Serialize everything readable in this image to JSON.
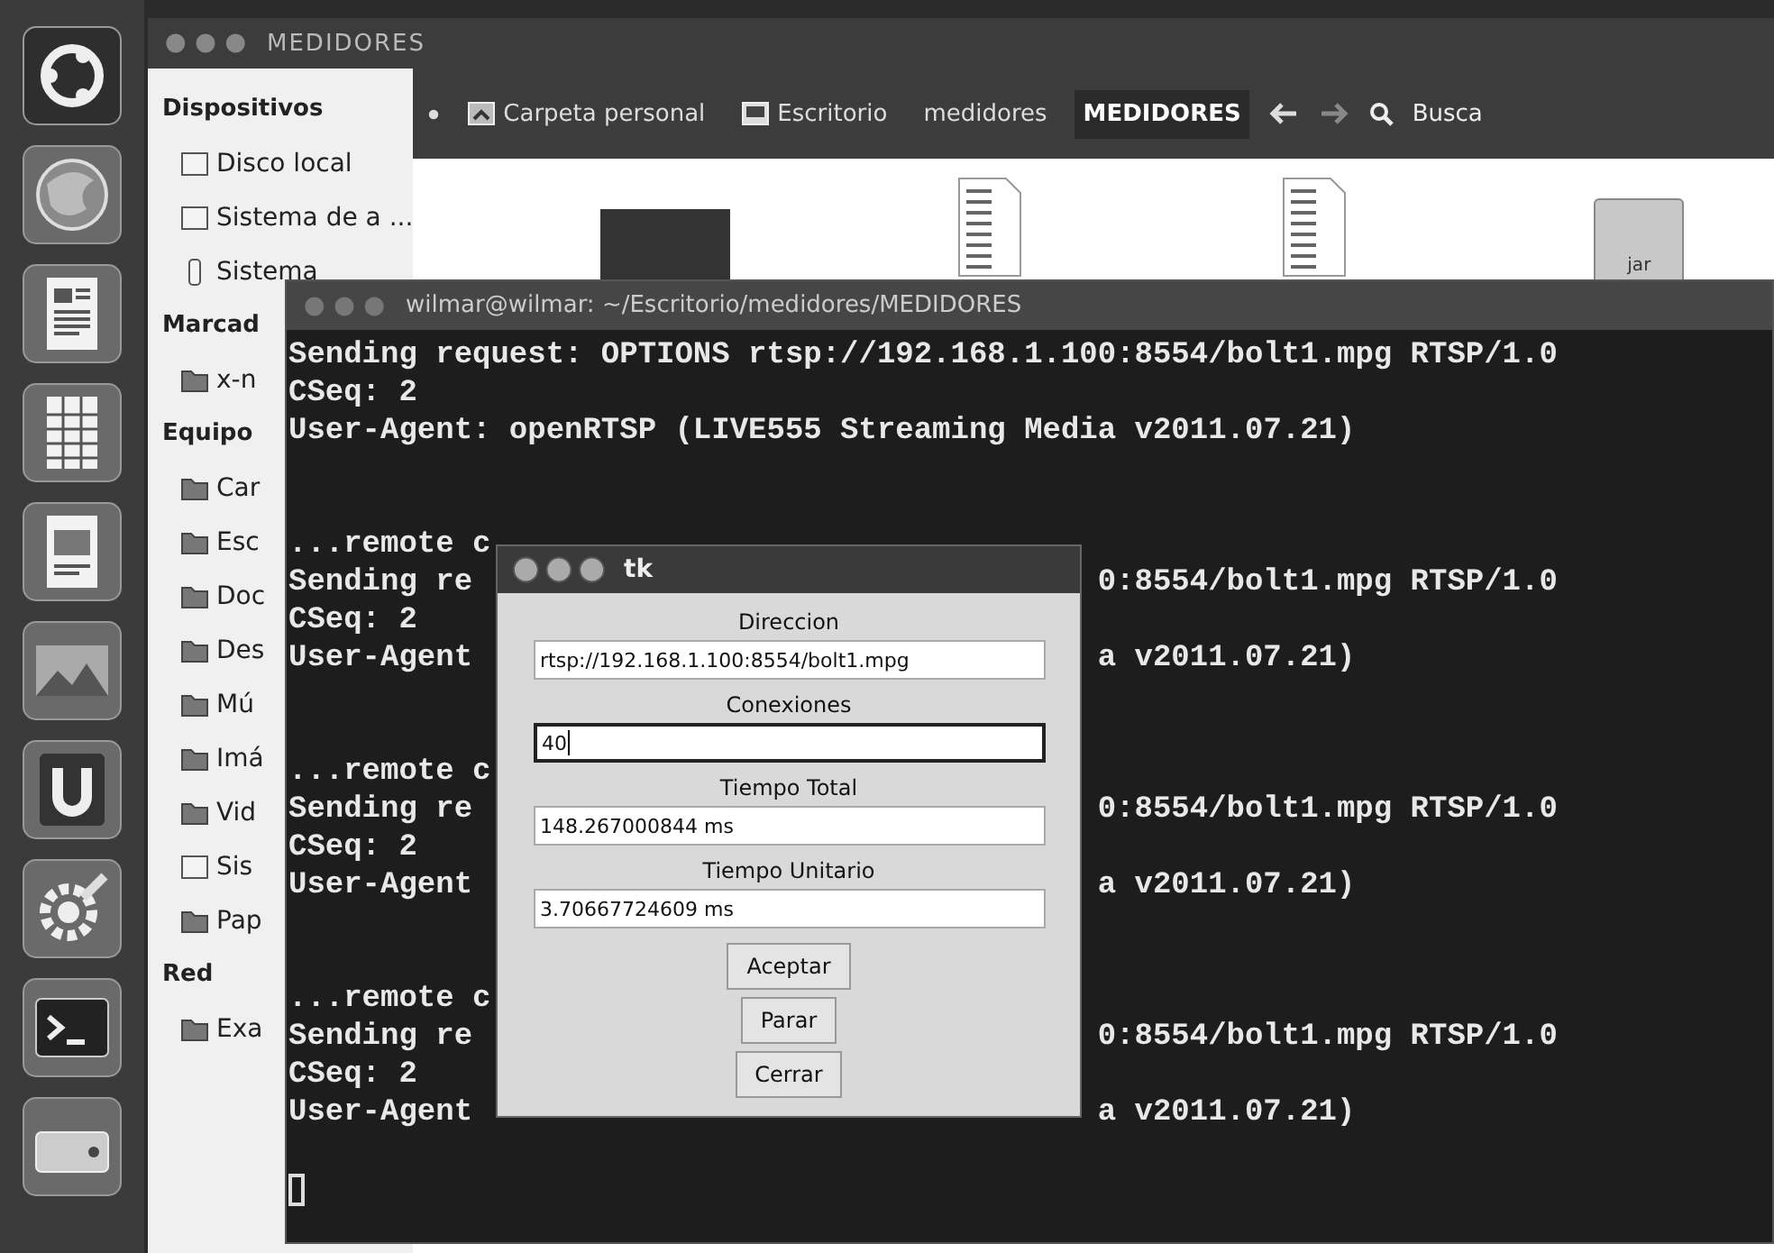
{
  "launcher": {
    "items": [
      {
        "kind": "logo"
      },
      {
        "kind": "globe"
      },
      {
        "kind": "document"
      },
      {
        "kind": "spreadsheet"
      },
      {
        "kind": "presentation"
      },
      {
        "kind": "photo"
      },
      {
        "kind": "app"
      },
      {
        "kind": "settings"
      },
      {
        "kind": "terminal"
      },
      {
        "kind": "drive"
      }
    ]
  },
  "file_manager": {
    "title": "MEDIDORES",
    "breadcrumbs": [
      {
        "label": "Carpeta personal",
        "kind": "home",
        "selected": false
      },
      {
        "label": "Escritorio",
        "kind": "desktop",
        "selected": false
      },
      {
        "label": "medidores",
        "kind": "plain",
        "selected": false
      },
      {
        "label": "MEDIDORES",
        "kind": "plain",
        "selected": true
      }
    ],
    "search_label": "Busca",
    "sidebar": {
      "sections": [
        {
          "heading": "Dispositivos",
          "items": [
            {
              "label": "Disco local",
              "kind": "drive"
            },
            {
              "label": "Sistema de a ...",
              "kind": "drive"
            },
            {
              "label": "Sistema",
              "kind": "usb"
            }
          ]
        },
        {
          "heading": "Marcad",
          "items": [
            {
              "label": "x-n",
              "kind": "folder"
            }
          ]
        },
        {
          "heading": "Equipo",
          "items": [
            {
              "label": "Car",
              "kind": "folder"
            },
            {
              "label": "Esc",
              "kind": "folder"
            },
            {
              "label": "Doc",
              "kind": "folder"
            },
            {
              "label": "Des",
              "kind": "folder"
            },
            {
              "label": "Mú",
              "kind": "folder"
            },
            {
              "label": "Imá",
              "kind": "folder"
            },
            {
              "label": "Vid",
              "kind": "folder"
            },
            {
              "label": "Sis",
              "kind": "drive"
            },
            {
              "label": "Pap",
              "kind": "folder"
            }
          ]
        },
        {
          "heading": "Red",
          "items": [
            {
              "label": "Exa",
              "kind": "folder"
            }
          ]
        }
      ]
    },
    "files": [
      {
        "kind": "image"
      },
      {
        "kind": "text"
      },
      {
        "kind": "text"
      },
      {
        "kind": "archive",
        "badge": "jar"
      }
    ]
  },
  "terminal": {
    "title": "wilmar@wilmar: ~/Escritorio/medidores/MEDIDORES",
    "lines": [
      {
        "kind": "text",
        "left": "Sending request: OPTIONS rtsp://192.168.1.100:8554/bolt1.mpg RTSP/1.0"
      },
      {
        "kind": "text",
        "left": "CSeq: 2"
      },
      {
        "kind": "text",
        "left": "User-Agent: openRTSP (LIVE555 Streaming Media v2011.07.21)"
      },
      {
        "kind": "blank"
      },
      {
        "kind": "blank"
      },
      {
        "kind": "text",
        "left": "...remote c"
      },
      {
        "kind": "text",
        "left": "Sending re",
        "right": "0:8554/bolt1.mpg RTSP/1.0"
      },
      {
        "kind": "text",
        "left": "CSeq: 2"
      },
      {
        "kind": "text",
        "left": "User-Agent",
        "right": "a v2011.07.21)"
      },
      {
        "kind": "blank"
      },
      {
        "kind": "blank"
      },
      {
        "kind": "text",
        "left": "...remote c"
      },
      {
        "kind": "text",
        "left": "Sending re",
        "right": "0:8554/bolt1.mpg RTSP/1.0"
      },
      {
        "kind": "text",
        "left": "CSeq: 2"
      },
      {
        "kind": "text",
        "left": "User-Agent",
        "right": "a v2011.07.21)"
      },
      {
        "kind": "blank"
      },
      {
        "kind": "blank"
      },
      {
        "kind": "text",
        "left": "...remote c"
      },
      {
        "kind": "text",
        "left": "Sending re",
        "right": "0:8554/bolt1.mpg RTSP/1.0"
      },
      {
        "kind": "text",
        "left": "CSeq: 2"
      },
      {
        "kind": "text",
        "left": "User-Agent",
        "right": "a v2011.07.21)"
      },
      {
        "kind": "blank"
      },
      {
        "kind": "cursor"
      }
    ]
  },
  "dialog": {
    "title": "tk",
    "fields": [
      {
        "label": "Direccion",
        "value": "rtsp://192.168.1.100:8554/bolt1.mpg",
        "focused": false
      },
      {
        "label": "Conexiones",
        "value": "40",
        "focused": true
      },
      {
        "label": "Tiempo Total",
        "value": "148.267000844 ms",
        "focused": false
      },
      {
        "label": "Tiempo Unitario",
        "value": "3.70667724609 ms",
        "focused": false
      }
    ],
    "buttons": [
      "Aceptar",
      "Parar",
      "Cerrar"
    ]
  }
}
